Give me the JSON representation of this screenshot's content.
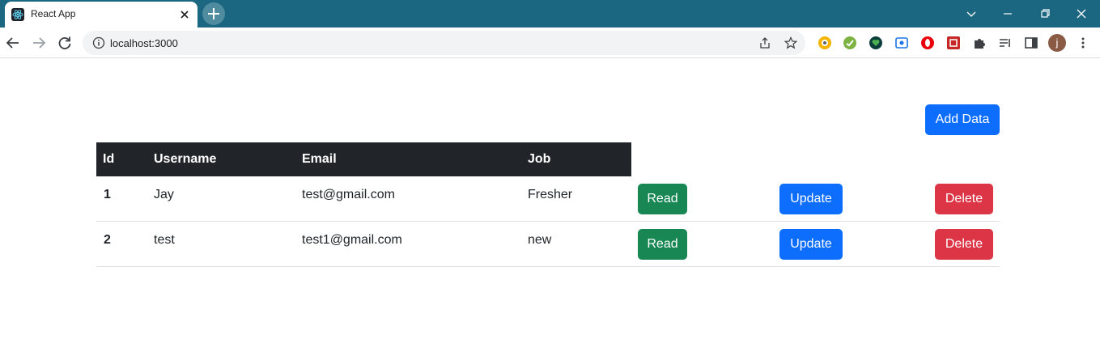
{
  "browser": {
    "tab_title": "React App",
    "url": "localhost:3000",
    "profile_initial": "j"
  },
  "colors": {
    "titlebar": "#1b6680",
    "primary": "#0d6efd",
    "success": "#198754",
    "danger": "#dc3545",
    "table_header": "#212529"
  },
  "page": {
    "add_button": "Add Data",
    "table": {
      "headers": [
        "Id",
        "Username",
        "Email",
        "Job"
      ],
      "rows": [
        {
          "id": "1",
          "username": "Jay",
          "email": "test@gmail.com",
          "job": "Fresher"
        },
        {
          "id": "2",
          "username": "test",
          "email": "test1@gmail.com",
          "job": "new"
        }
      ],
      "actions": {
        "read": "Read",
        "update": "Update",
        "delete": "Delete"
      }
    }
  }
}
